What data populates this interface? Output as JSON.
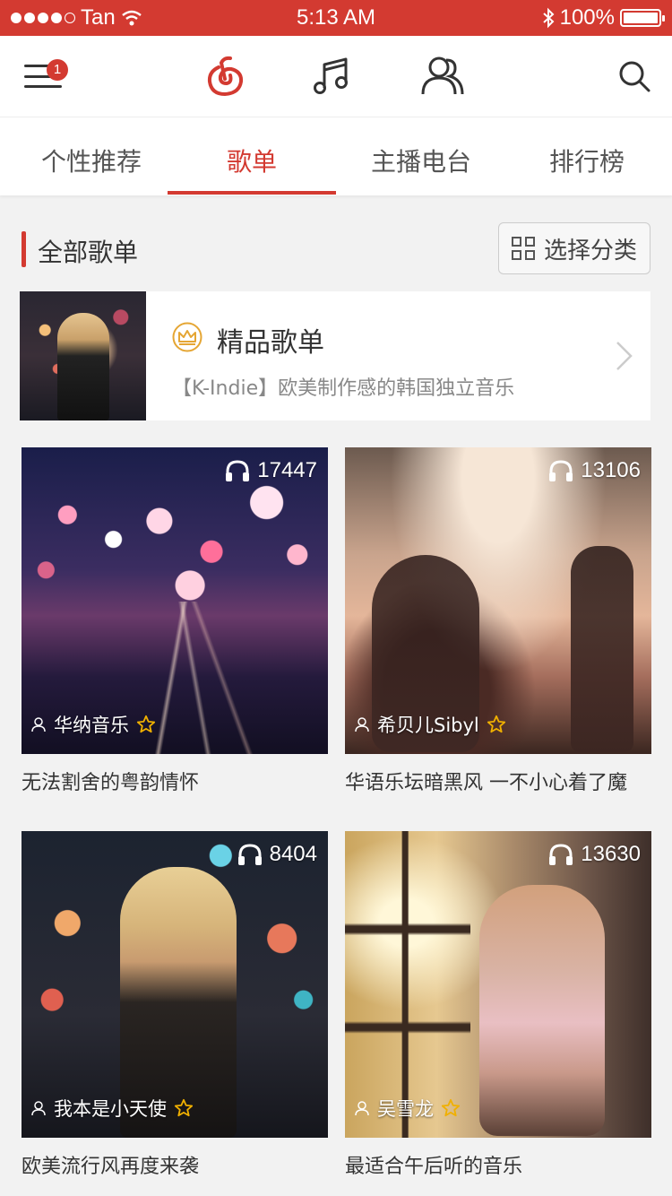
{
  "status_bar": {
    "carrier": "Tan",
    "time": "5:13 AM",
    "battery": "100%"
  },
  "top_nav": {
    "notification_count": "1"
  },
  "tabs": [
    {
      "label": "个性推荐",
      "active": false
    },
    {
      "label": "歌单",
      "active": true
    },
    {
      "label": "主播电台",
      "active": false
    },
    {
      "label": "排行榜",
      "active": false
    }
  ],
  "section": {
    "title": "全部歌单",
    "filter_label": "选择分类"
  },
  "featured": {
    "title": "精品歌单",
    "subtitle": "【K-Indie】欧美制作感的韩国独立音乐"
  },
  "playlists": [
    {
      "play_count": "17447",
      "creator": "华纳音乐",
      "title": "无法割舍的粤韵情怀"
    },
    {
      "play_count": "13106",
      "creator": "希贝儿Sibyl",
      "title": "华语乐坛暗黑风 一不小心着了魔"
    },
    {
      "play_count": "8404",
      "creator": "我本是小天使",
      "title": "欧美流行风再度来袭"
    },
    {
      "play_count": "13630",
      "creator": "吴雪龙",
      "title": "最适合午后听的音乐"
    }
  ],
  "colors": {
    "accent": "#d33a31",
    "gold": "#e5a634"
  }
}
